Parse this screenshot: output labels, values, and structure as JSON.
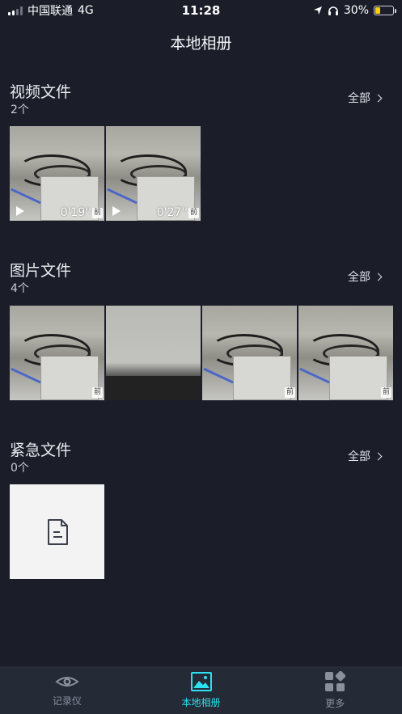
{
  "status_bar": {
    "carrier": "中国联通",
    "network": "4G",
    "time": "11:28",
    "battery": "30%",
    "battery_level": 0.3,
    "icons": [
      "signal-icon",
      "location-arrow-icon",
      "headphones-icon",
      "battery-icon"
    ]
  },
  "header": {
    "title": "本地相册"
  },
  "sections": [
    {
      "title": "视频文件",
      "count": "2个",
      "all_label": "全部",
      "items": [
        {
          "duration": "0'19''",
          "badge": "前"
        },
        {
          "duration": "0'27''",
          "badge": "前"
        }
      ]
    },
    {
      "title": "图片文件",
      "count": "4个",
      "all_label": "全部",
      "items": [
        {
          "badge": "前"
        },
        {
          "badge": ""
        },
        {
          "badge": "前"
        },
        {
          "badge": "前"
        }
      ]
    },
    {
      "title": "紧急文件",
      "count": "0个",
      "all_label": "全部",
      "items": []
    }
  ],
  "tabbar": {
    "tabs": [
      {
        "label": "记录仪",
        "icon": "dashcam-icon",
        "active": false
      },
      {
        "label": "本地相册",
        "icon": "album-icon",
        "active": true
      },
      {
        "label": "更多",
        "icon": "more-grid-icon",
        "active": false
      }
    ],
    "colors": {
      "active": "#2de0f0",
      "inactive": "#8c909d",
      "background": "#252a37"
    }
  },
  "colors": {
    "background": "#1b1e29",
    "text": "#e6e8ee"
  }
}
